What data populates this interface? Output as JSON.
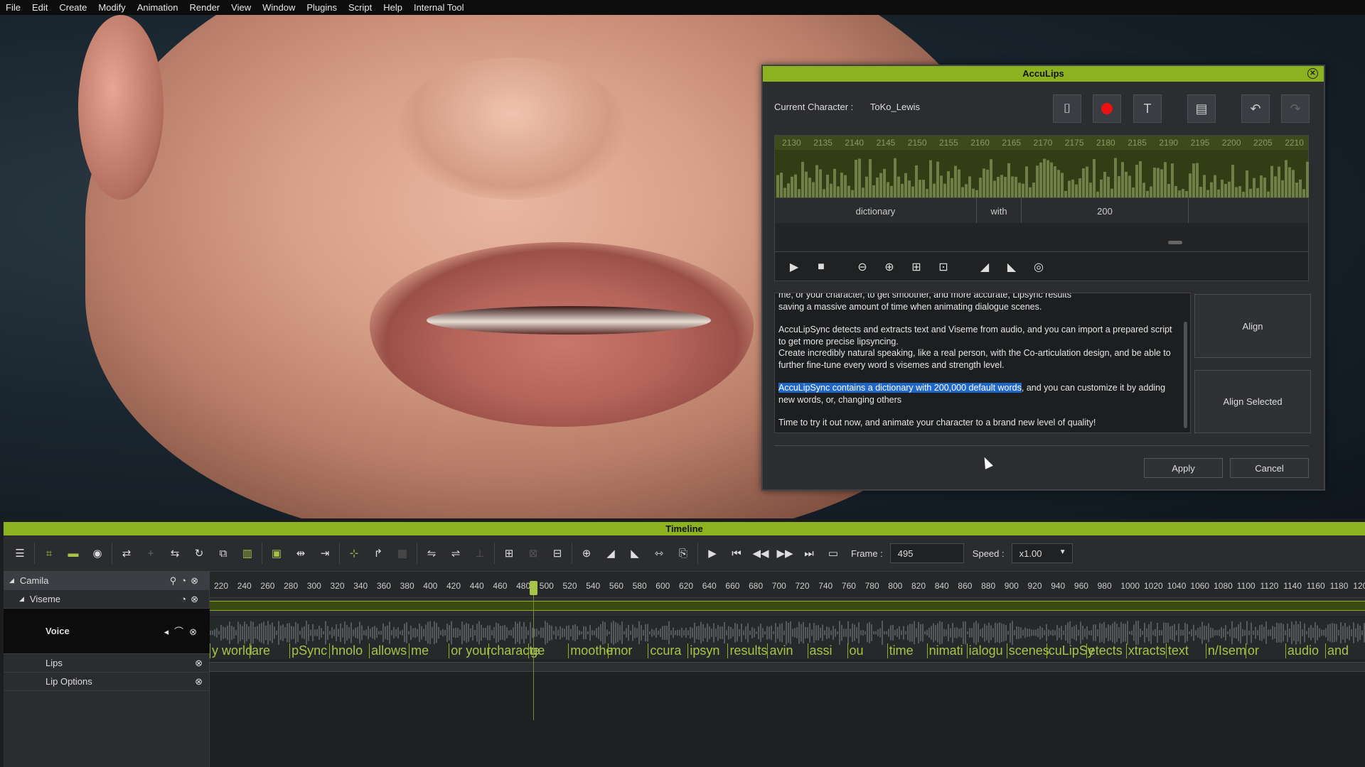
{
  "menu": [
    "File",
    "Edit",
    "Create",
    "Modify",
    "Animation",
    "Render",
    "View",
    "Window",
    "Plugins",
    "Script",
    "Help",
    "Internal Tool"
  ],
  "dialog": {
    "title": "AccuLips",
    "close": "✕",
    "char_label": "Current Character :",
    "char_value": "ToKo_Lewis",
    "ruler": [
      "2130",
      "2135",
      "2140",
      "2145",
      "2150",
      "2155",
      "2160",
      "2165",
      "2170",
      "2175",
      "2180",
      "2185",
      "2190",
      "2195",
      "2200",
      "2205",
      "2210"
    ],
    "words": [
      "dictionary",
      "with",
      "200",
      ""
    ],
    "text": {
      "p1a": "me, or your character, to get smoother, and more accurate, Lipsync results",
      "p1b": "saving a massive amount of time when animating dialogue scenes.",
      "p2": "AccuLipSync detects and extracts text and Viseme from audio, and you can import a prepared script to get more precise lipsyncing.",
      "p3": "Create incredibly natural speaking, like a real person, with the Co-articulation design, and be able to further fine-tune every word s visemes and strength level.",
      "p4_hl": "AccuLipSync contains a dictionary with 200,000 default words",
      "p4_rest": ", and you can customize it by adding new words, or, changing others",
      "p5": "Time to try it out now, and animate your character to a brand new level of quality!"
    },
    "align": "Align",
    "align_selected": "Align Selected",
    "apply": "Apply",
    "cancel": "Cancel"
  },
  "timeline": {
    "title": "Timeline",
    "frame_label": "Frame :",
    "frame_value": "495",
    "speed_label": "Speed :",
    "speed_value": "x1.00",
    "ticks": [
      "220",
      "240",
      "260",
      "280",
      "300",
      "320",
      "340",
      "360",
      "380",
      "400",
      "420",
      "440",
      "460",
      "480",
      "500",
      "520",
      "540",
      "560",
      "580",
      "600",
      "620",
      "640",
      "660",
      "680",
      "700",
      "720",
      "740",
      "760",
      "780",
      "800",
      "820",
      "840",
      "860",
      "880",
      "900",
      "920",
      "940",
      "960",
      "980",
      "1000",
      "1020",
      "1040",
      "1060",
      "1080",
      "1100",
      "1120",
      "1140",
      "1160",
      "1180",
      "120"
    ],
    "tracks": {
      "camila": "Camila",
      "viseme": "Viseme",
      "voice": "Voice",
      "lips": "Lips",
      "lip_options": "Lip Options"
    },
    "voice_words": [
      "y world",
      "are",
      "pSync",
      "hnolo",
      "allows",
      "me",
      "or your",
      "characte",
      "ge",
      "moothe",
      "mor",
      "ccura",
      "ipsyn",
      "results",
      "avin",
      "assi",
      "ou",
      "time",
      "nimati",
      "ialogu",
      "scenes",
      "cuLipSy",
      "etects",
      "xtracts",
      "text",
      "n/Isem",
      "or",
      "audio",
      "and"
    ]
  },
  "colors": {
    "accent": "#8db21f",
    "highlight": "#1f66c9"
  }
}
